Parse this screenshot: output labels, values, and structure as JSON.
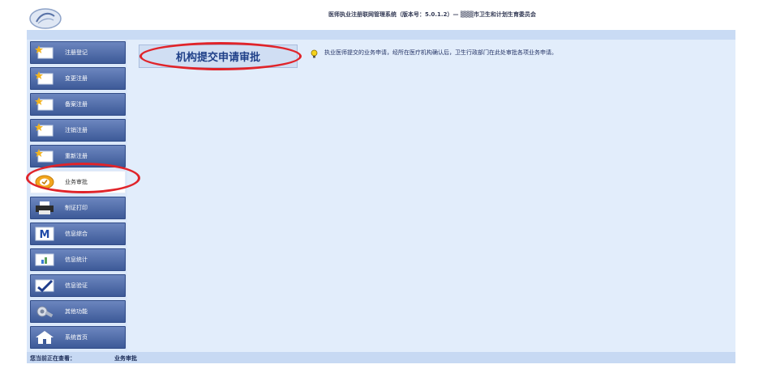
{
  "header": {
    "title": "医师执业注册联网管理系统（版本号：5.0.1.2）— ▒▒▒市卫生和计划生育委员会"
  },
  "sidebar": {
    "items": [
      {
        "label": "注册登记",
        "icon": "star-card-icon"
      },
      {
        "label": "变更注册",
        "icon": "star-card-icon"
      },
      {
        "label": "备案注册",
        "icon": "star-card-icon"
      },
      {
        "label": "注销注册",
        "icon": "star-card-icon"
      },
      {
        "label": "重新注册",
        "icon": "star-card-icon"
      },
      {
        "label": "业务审批",
        "icon": "approval-badge-icon"
      },
      {
        "label": "制证打印",
        "icon": "printer-icon"
      },
      {
        "label": "信息综合",
        "icon": "m-letter-icon"
      },
      {
        "label": "信息统计",
        "icon": "stats-card-icon"
      },
      {
        "label": "信息验证",
        "icon": "check-mark-icon"
      },
      {
        "label": "其他功能",
        "icon": "tools-icon"
      },
      {
        "label": "系统首页",
        "icon": "home-icon"
      }
    ],
    "active_index": 5
  },
  "main": {
    "tab_label": "机构提交申请审批",
    "hint": "执业医师提交的业务申请，经所在医疗机构确认后，卫生行政部门在此处审批各项业务申请。"
  },
  "status": {
    "label": "您当前正在查看：",
    "value": "业务审批"
  },
  "colors": {
    "highlight_ring": "#e0242a",
    "nav_blue": "#3d5a98",
    "background": "#e2edfb"
  }
}
